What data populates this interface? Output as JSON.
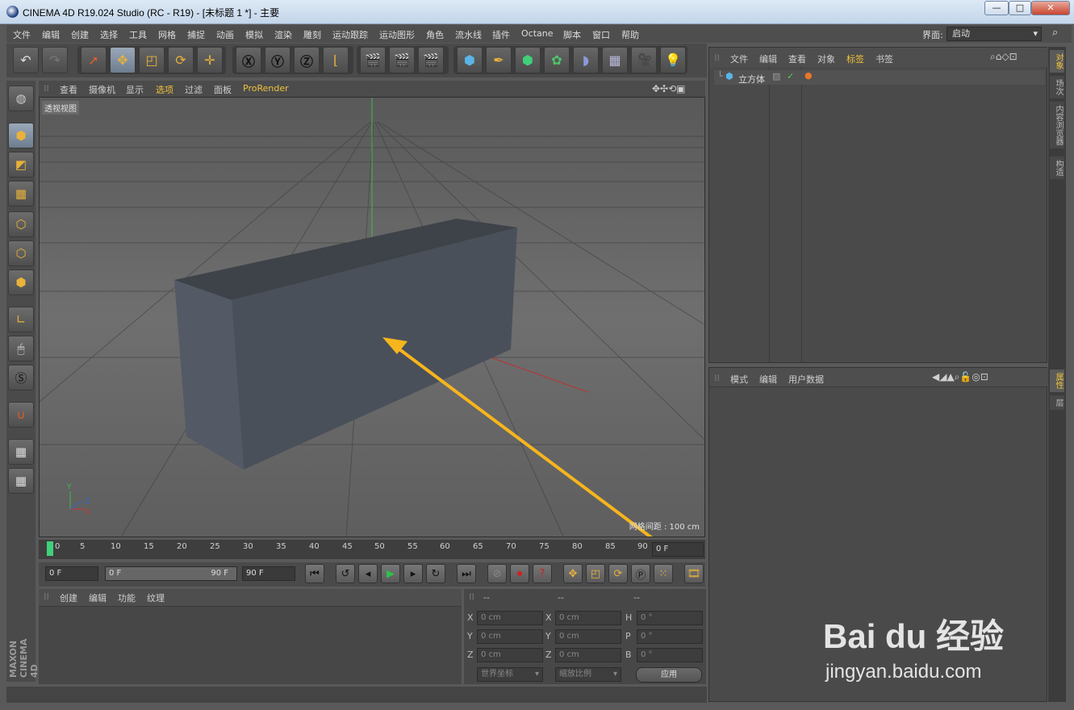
{
  "window": {
    "title": "CINEMA 4D R19.024 Studio (RC - R19) - [未标题 1 *] - 主要",
    "min": "—",
    "max": "□",
    "close": "✕"
  },
  "menu": [
    "文件",
    "编辑",
    "创建",
    "选择",
    "工具",
    "网格",
    "捕捉",
    "动画",
    "模拟",
    "渲染",
    "雕刻",
    "运动跟踪",
    "运动图形",
    "角色",
    "流水线",
    "插件",
    "Octane",
    "脚本",
    "窗口",
    "帮助"
  ],
  "layout": {
    "label": "界面:",
    "value": "启动"
  },
  "viewport": {
    "menu": [
      "查看",
      "摄像机",
      "显示",
      "选项",
      "过滤",
      "面板",
      "ProRender"
    ],
    "label": "透视视图",
    "grid_info": "网格间距 : 100 cm"
  },
  "timeline": {
    "ticks": [
      "0",
      "5",
      "10",
      "15",
      "20",
      "25",
      "30",
      "35",
      "40",
      "45",
      "50",
      "55",
      "60",
      "65",
      "70",
      "75",
      "80",
      "85",
      "90"
    ],
    "current": "0 F"
  },
  "transport": {
    "start": "0 F",
    "range_start": "0 F",
    "range_end": "90 F",
    "end": "90 F"
  },
  "material": {
    "menu": [
      "创建",
      "编辑",
      "功能",
      "纹理"
    ]
  },
  "coords": {
    "headers": [
      "--",
      "--",
      "--"
    ],
    "rows": [
      {
        "a": "X",
        "av": "0 cm",
        "b": "X",
        "bv": "0 cm",
        "c": "H",
        "cv": "0 °"
      },
      {
        "a": "Y",
        "av": "0 cm",
        "b": "Y",
        "bv": "0 cm",
        "c": "P",
        "cv": "0 °"
      },
      {
        "a": "Z",
        "av": "0 cm",
        "b": "Z",
        "bv": "0 cm",
        "c": "B",
        "cv": "0 °"
      }
    ],
    "space": "世界坐标",
    "scale": "缩放比例",
    "apply": "应用"
  },
  "objects": {
    "menu": [
      "文件",
      "编辑",
      "查看",
      "对象",
      "标签",
      "书签"
    ],
    "items": [
      "立方体"
    ]
  },
  "attributes": {
    "menu": [
      "模式",
      "编辑",
      "用户数据"
    ]
  },
  "right_tabs": [
    "对象",
    "场次",
    "内容浏览器",
    "构造",
    "属性",
    "层"
  ],
  "brand": [
    "MAXON",
    "CINEMA 4D"
  ],
  "watermark": {
    "logo": "Bai du 经验",
    "url": "jingyan.baidu.com"
  }
}
